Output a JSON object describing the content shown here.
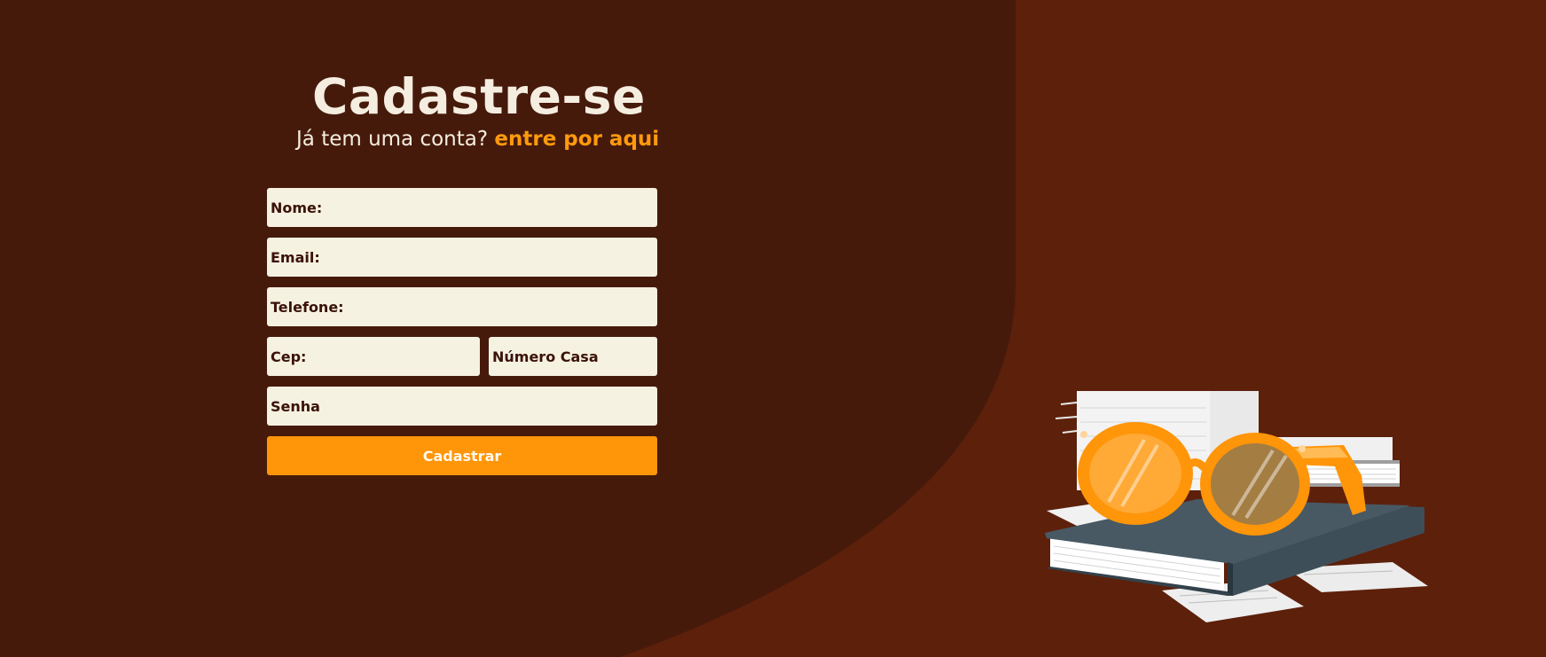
{
  "form": {
    "title": "Cadastre-se",
    "subtitle_text": "Já tem uma conta?",
    "login_link": "entre por aqui",
    "fields": {
      "nome": {
        "placeholder": "Nome:",
        "value": ""
      },
      "email": {
        "placeholder": "Email:",
        "value": ""
      },
      "telefone": {
        "placeholder": "Telefone:",
        "value": ""
      },
      "cep": {
        "placeholder": "Cep:",
        "value": ""
      },
      "numero_casa": {
        "placeholder": "Número Casa",
        "value": ""
      },
      "senha": {
        "placeholder": "Senha",
        "value": ""
      }
    },
    "submit_label": "Cadastrar"
  },
  "illustration": {
    "icon": "books-and-glasses-illustration"
  },
  "colors": {
    "background_dark": "#461a0b",
    "background_light": "#5d200b",
    "accent": "#ff9509",
    "title_text": "#f5eee0",
    "field_bg": "#f6f2e2",
    "field_text": "#3a1208",
    "book_cover": "#3e4e58",
    "glasses": "#ff9509"
  }
}
